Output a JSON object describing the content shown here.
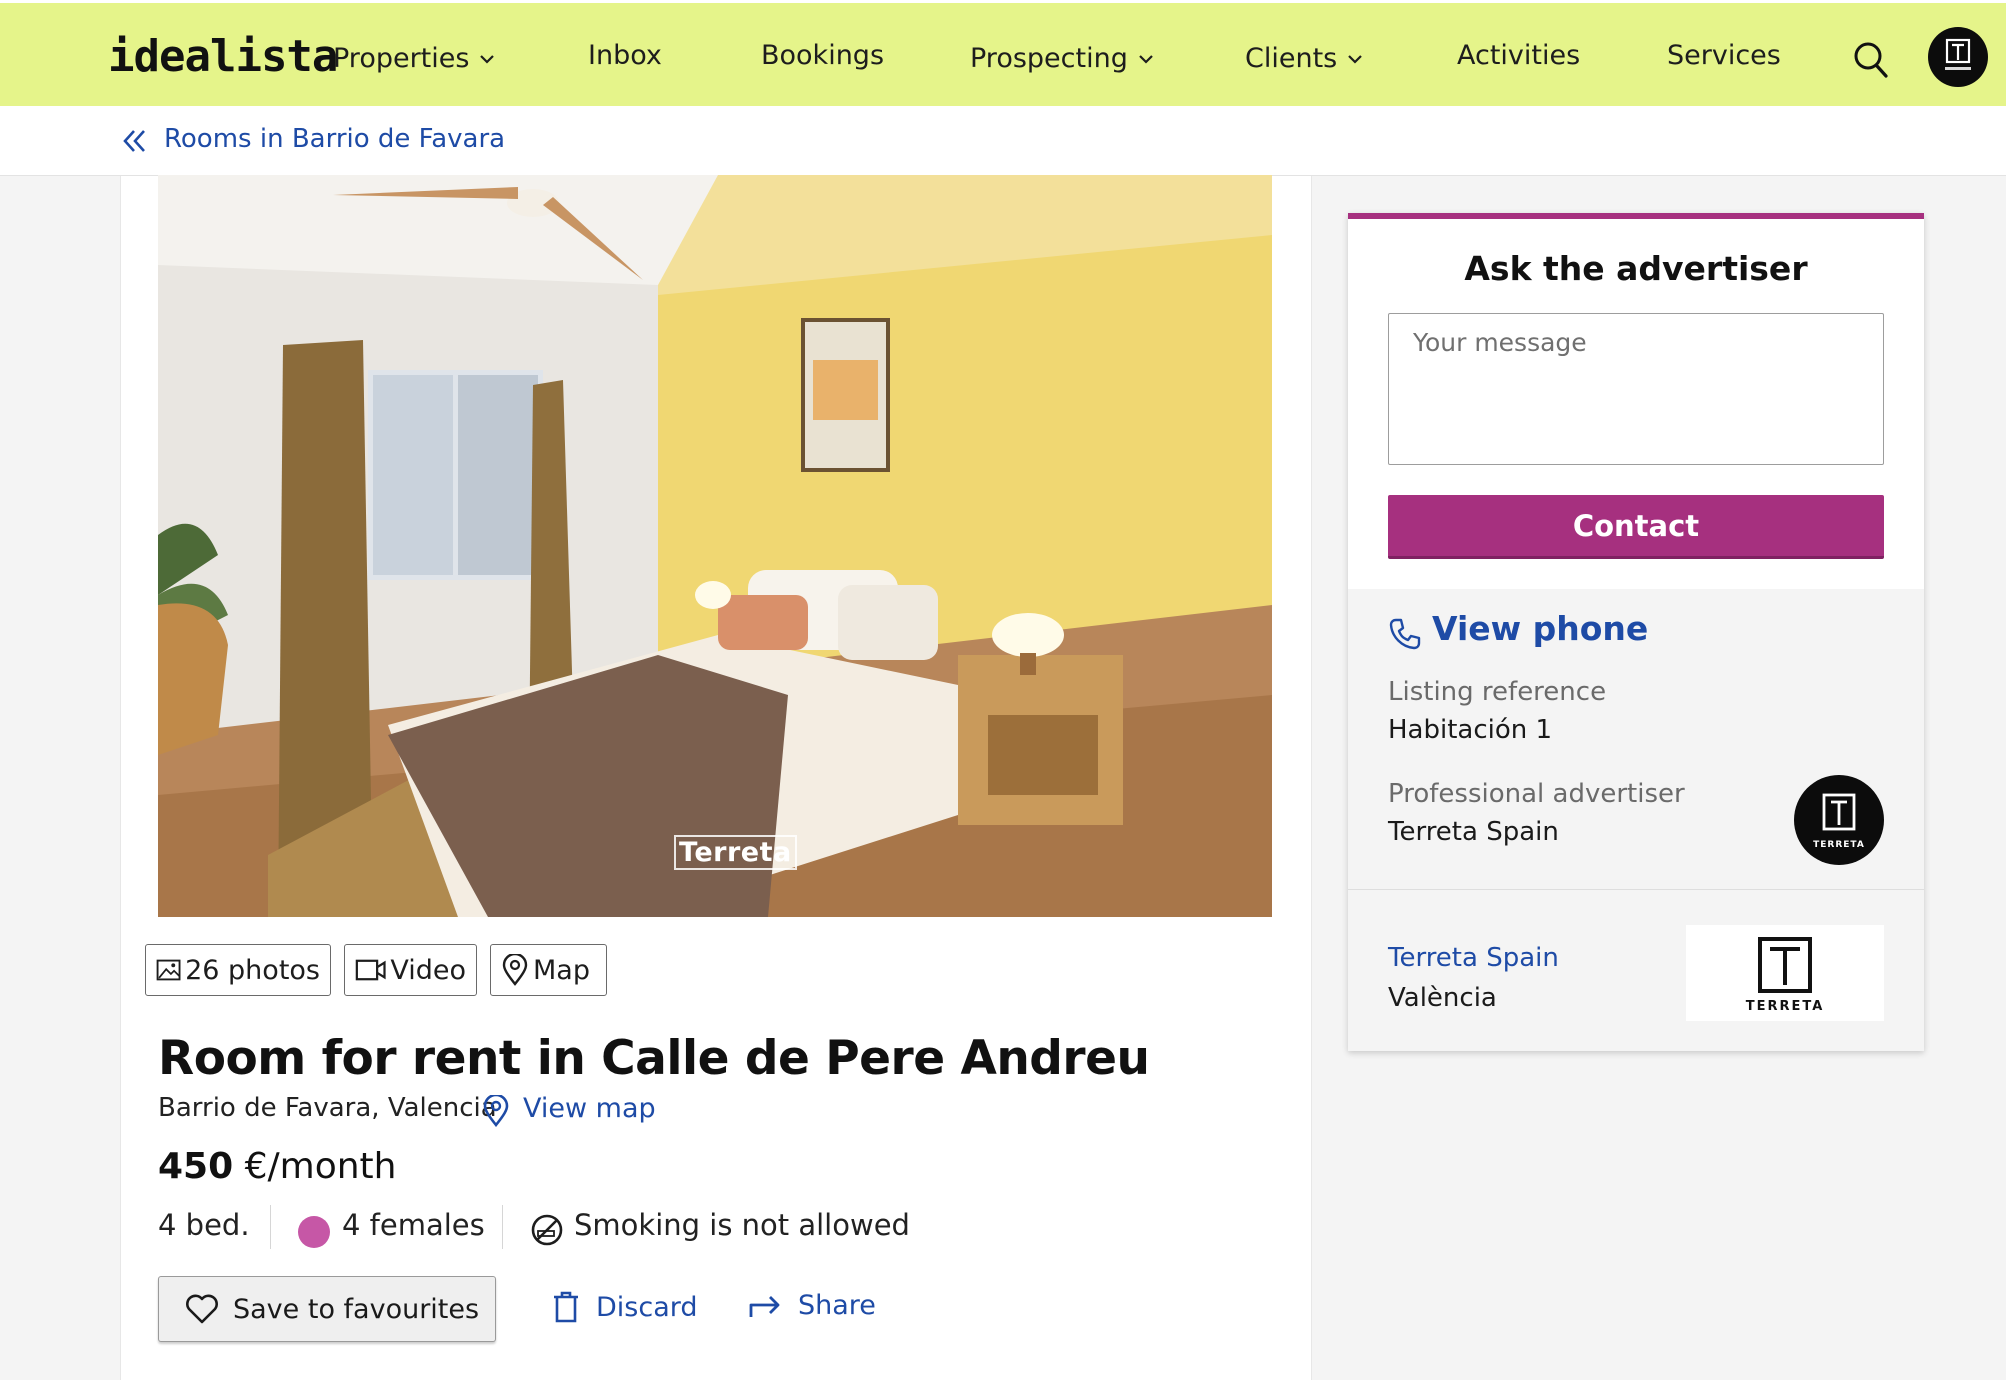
{
  "header": {
    "logo": "idealista",
    "nav": [
      {
        "label": "Properties",
        "dropdown": true
      },
      {
        "label": "Inbox",
        "dropdown": false
      },
      {
        "label": "Bookings",
        "dropdown": false
      },
      {
        "label": "Prospecting",
        "dropdown": true
      },
      {
        "label": "Clients",
        "dropdown": true
      },
      {
        "label": "Activities",
        "dropdown": false
      },
      {
        "label": "Services",
        "dropdown": false
      }
    ],
    "search_icon": "search-icon",
    "account_logo": "terreta-logo"
  },
  "breadcrumb": {
    "icon": "double-chevron-left-icon",
    "label": "Rooms in Barrio de Favara"
  },
  "listing": {
    "photo_watermark": "Terreta",
    "media_buttons": {
      "photos": "26 photos",
      "video": "Video",
      "map": "Map"
    },
    "title": "Room for rent in Calle de Pere Andreu",
    "location": "Barrio de Favara, Valencia",
    "view_map": "View map",
    "price_amount": "450",
    "price_unit": "€/month",
    "features": {
      "beds": "4 bed.",
      "occupants": "4 females",
      "smoking": "Smoking is not allowed"
    },
    "actions": {
      "save": "Save to favourites",
      "discard": "Discard",
      "share": "Share"
    }
  },
  "contact": {
    "title": "Ask the advertiser",
    "message_placeholder": "Your message",
    "contact_button": "Contact",
    "view_phone": "View phone",
    "reference_label": "Listing reference",
    "reference_value": "Habitación 1",
    "advertiser_label": "Professional advertiser",
    "advertiser_name": "Terreta Spain",
    "agency_name": "Terreta Spain",
    "agency_city": "València",
    "logo_text": "TERRETA"
  },
  "colors": {
    "header_bg": "#e5f48a",
    "link": "#1e4ba6",
    "accent": "#a6307f",
    "female_dot": "#c657a6"
  }
}
